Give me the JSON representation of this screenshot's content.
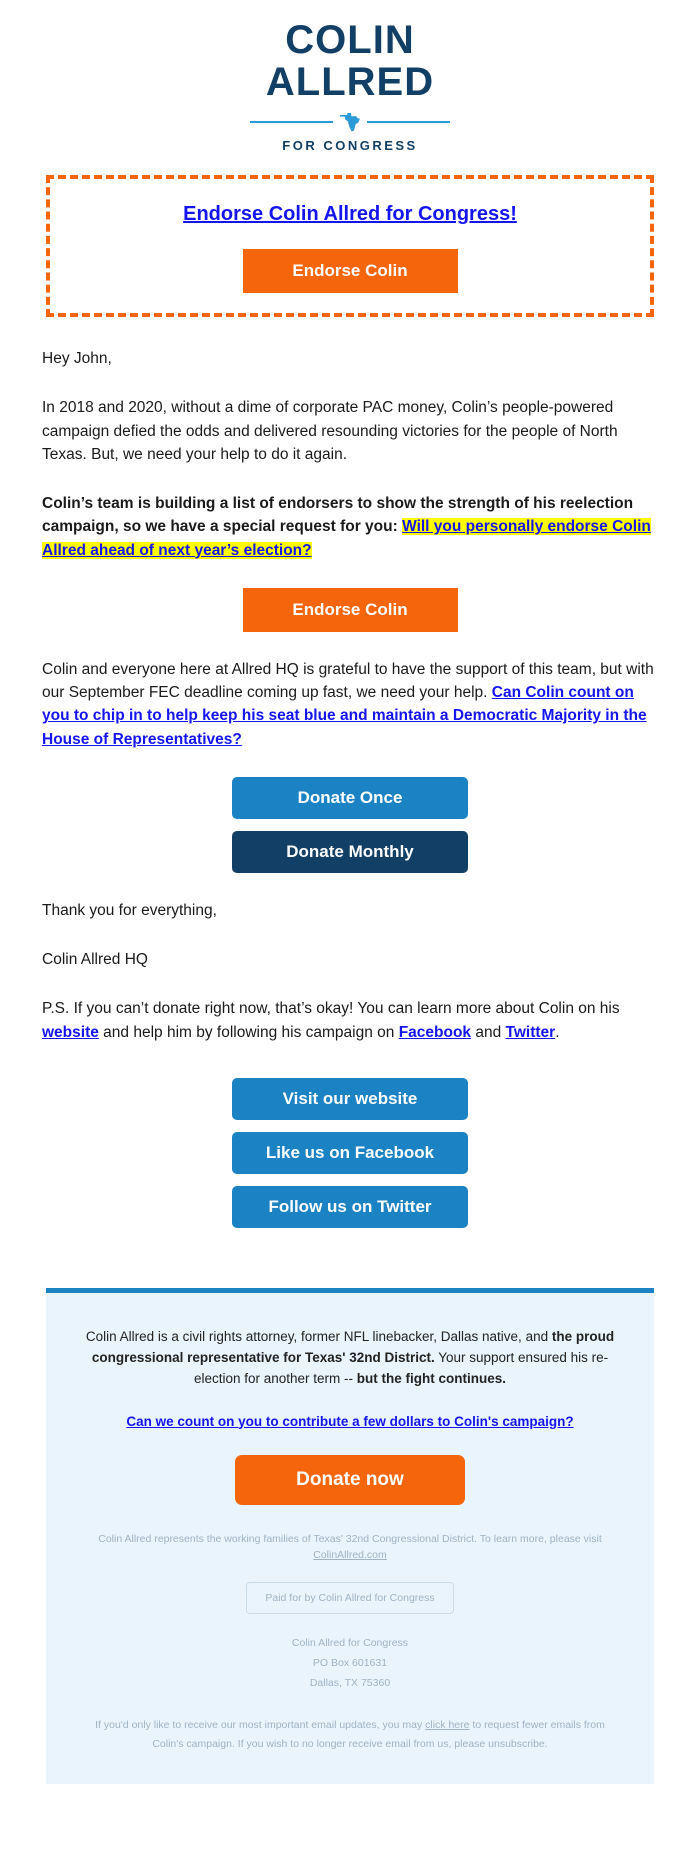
{
  "logo": {
    "line1": "COLIN",
    "line2": "ALLRED",
    "subtitle": "FOR CONGRESS",
    "navy": "#123F65",
    "accent_blue": "#2C9AD6"
  },
  "endorse_box": {
    "headline_link": "Endorse Colin Allred for Congress!",
    "button_label": "Endorse Colin",
    "border_color": "#F4650C",
    "link_color": "#1414EE"
  },
  "body": {
    "greeting": "Hey John,",
    "para1": "In 2018 and 2020, without a dime of corporate PAC money, Colin’s people-powered campaign defied the odds and delivered resounding victories for the people of North Texas. But, we need your help to do it again.",
    "para2_bold": "Colin’s team is building a list of endorsers to show the strength of his reelection campaign, so we have a special request for you: ",
    "para2_highlight": "Will you personally endorse Colin Allred ahead of next year’s election?",
    "endorse_button_label": "Endorse Colin",
    "para3_plain": "Colin and everyone here at Allred HQ is grateful to have the support of this team, but with our September FEC deadline coming up fast, we need your help. ",
    "para3_link": "Can Colin count on you to chip in to help keep his seat blue and maintain a Democratic Majority in the House of Representatives?",
    "donate_once_label": "Donate Once",
    "donate_monthly_label": "Donate Monthly",
    "thanks": "Thank you for everything,",
    "signature": "Colin Allred HQ",
    "ps_prefix": "P.S. If you can’t donate right now, that’s okay! You can learn more about Colin on his ",
    "ps_link_website": "website",
    "ps_mid": " and help him by following his campaign on ",
    "ps_link_facebook": "Facebook",
    "ps_and": " and ",
    "ps_link_twitter": "Twitter",
    "ps_end": ".",
    "social": {
      "website_label": "Visit our website",
      "facebook_label": "Like us on Facebook",
      "twitter_label": "Follow us on Twitter"
    }
  },
  "footer": {
    "bio_part1": "Colin Allred is a civil rights attorney, former NFL linebacker, Dallas native, and ",
    "bio_bold1": "the proud congressional representative for Texas' 32nd District.",
    "bio_part2": " Your support ensured his re-election for another term -- ",
    "bio_bold2": "but the fight continues.",
    "cta_link": "Can we count on you to contribute a few dollars to Colin's campaign?",
    "donate_button_label": "Donate now",
    "disclaimer_prefix": "Colin Allred represents the working families of Texas' 32nd Congressional District. To learn more, please visit ",
    "disclaimer_link": "ColinAllred.com",
    "paid_for": "Paid for by Colin Allred for Congress",
    "address_line1": "Colin Allred for Congress",
    "address_line2": "PO Box 601631",
    "address_line3": "Dallas, TX 75360",
    "unsub_prefix": "If you'd only like to receive our most important email updates, you may ",
    "unsub_link": "click here",
    "unsub_suffix": " to request fewer emails from Colin's campaign. If you wish to no longer receive email from us, please unsubscribe."
  }
}
